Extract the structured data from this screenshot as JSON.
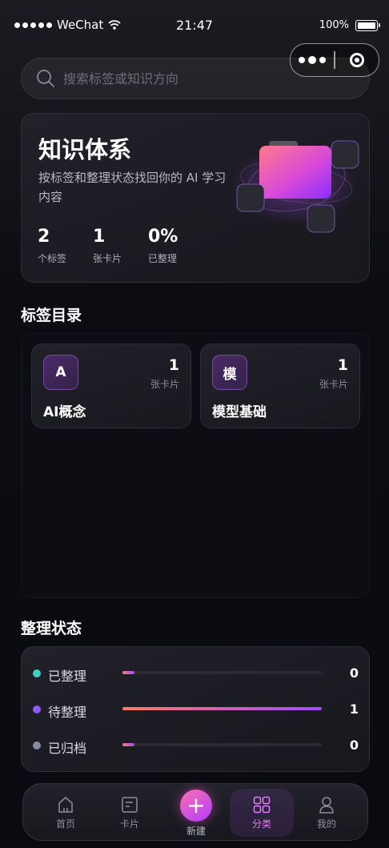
{
  "status_bar": {
    "carrier": "WeChat",
    "time": "21:47",
    "battery": "100%"
  },
  "search": {
    "placeholder": "搜索标签或知识方向"
  },
  "hero": {
    "title": "知识体系",
    "subtitle": "按标签和整理状态找回你的 AI 学习内容",
    "stats": [
      {
        "value": "2",
        "label": "个标签"
      },
      {
        "value": "1",
        "label": "张卡片"
      },
      {
        "value": "0%",
        "label": "已整理"
      }
    ]
  },
  "tags_section": {
    "title": "标签目录",
    "tags": [
      {
        "badge": "A",
        "name": "AI概念",
        "count": "1",
        "unit": "张卡片"
      },
      {
        "badge": "模",
        "name": "模型基础",
        "count": "1",
        "unit": "张卡片"
      }
    ]
  },
  "status_section": {
    "title": "整理状态",
    "rows": [
      {
        "label": "已整理",
        "value": "0",
        "progress": 0.06,
        "dot_color": "#3fd0c0"
      },
      {
        "label": "待整理",
        "value": "1",
        "progress": 1.0,
        "dot_color": "#8f5cff"
      },
      {
        "label": "已归档",
        "value": "0",
        "progress": 0.06,
        "dot_color": "#8a8aa0"
      }
    ]
  },
  "tabbar": {
    "items": [
      {
        "label": "首页",
        "icon": "home-icon"
      },
      {
        "label": "卡片",
        "icon": "card-icon"
      },
      {
        "label": "新建",
        "icon": "plus-icon"
      },
      {
        "label": "分类",
        "icon": "grid-icon",
        "active": true
      },
      {
        "label": "我的",
        "icon": "user-icon"
      }
    ]
  },
  "colors": {
    "accent": "#e57bff",
    "fab_start": "#ff6fb1",
    "fab_end": "#b03cff"
  }
}
